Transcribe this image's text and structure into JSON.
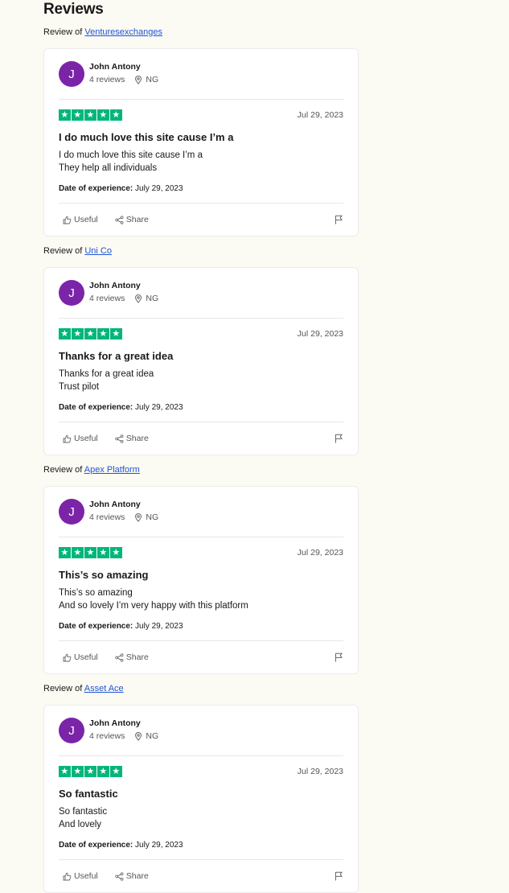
{
  "page": {
    "title": "Reviews",
    "review_of_label": "Review of"
  },
  "reviews": [
    {
      "company": "Venturesexchanges",
      "avatar_letter": "J",
      "name": "John Antony",
      "reviews_count": "4 reviews",
      "country": "NG",
      "rating": 5,
      "date": "Jul 29, 2023",
      "title": "I do much love this site cause I’m a",
      "body": [
        "I do much love this site cause I’m a",
        "They help all individuals"
      ],
      "experience_label": "Date of experience:",
      "experience_date": "July 29, 2023",
      "useful_label": "Useful",
      "share_label": "Share"
    },
    {
      "company": "Uni Co",
      "avatar_letter": "J",
      "name": "John Antony",
      "reviews_count": "4 reviews",
      "country": "NG",
      "rating": 5,
      "date": "Jul 29, 2023",
      "title": "Thanks for a great idea",
      "body": [
        "Thanks for a great idea",
        "Trust pilot"
      ],
      "experience_label": "Date of experience:",
      "experience_date": "July 29, 2023",
      "useful_label": "Useful",
      "share_label": "Share"
    },
    {
      "company": "Apex Platform",
      "avatar_letter": "J",
      "name": "John Antony",
      "reviews_count": "4 reviews",
      "country": "NG",
      "rating": 5,
      "date": "Jul 29, 2023",
      "title": "This’s so amazing",
      "body": [
        "This’s so amazing",
        "And so lovely I’m very happy with this platform"
      ],
      "experience_label": "Date of experience:",
      "experience_date": "July 29, 2023",
      "useful_label": "Useful",
      "share_label": "Share"
    },
    {
      "company": "Asset Ace",
      "avatar_letter": "J",
      "name": "John Antony",
      "reviews_count": "4 reviews",
      "country": "NG",
      "rating": 5,
      "date": "Jul 29, 2023",
      "title": "So fantastic",
      "body": [
        "So fantastic",
        "And lovely"
      ],
      "experience_label": "Date of experience:",
      "experience_date": "July 29, 2023",
      "useful_label": "Useful",
      "share_label": "Share"
    }
  ],
  "colors": {
    "star_green": "#00b67a",
    "avatar_purple": "#7b24a8",
    "link_blue": "#1f55d6",
    "background": "#fbfaf3"
  },
  "icons": {
    "star": "star-icon",
    "location": "location-pin-icon",
    "useful": "thumbs-up-icon",
    "share": "share-icon",
    "flag": "flag-icon"
  }
}
